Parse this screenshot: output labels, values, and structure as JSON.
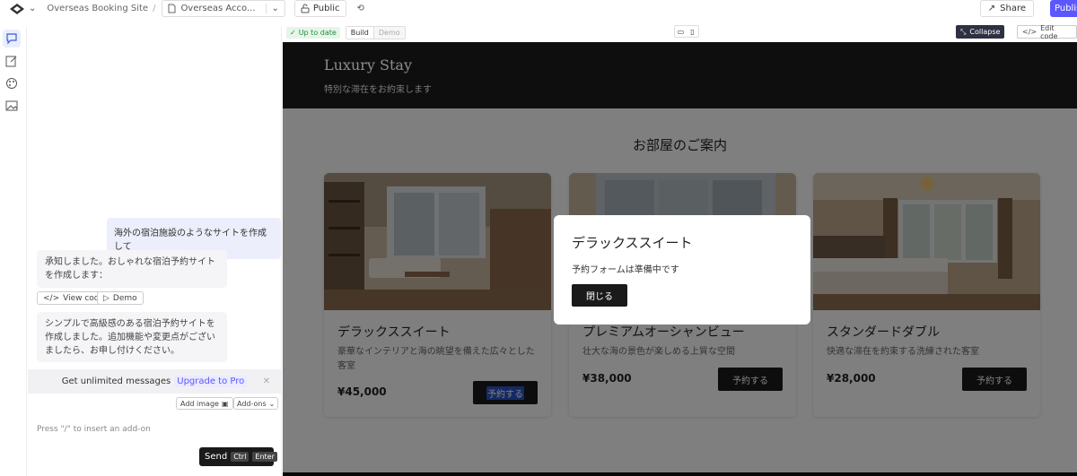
{
  "topbar": {
    "breadcrumb": "Overseas Booking Site",
    "page_name": "Overseas Acco...",
    "visibility": "Public",
    "share": "Share",
    "publish": "Publish"
  },
  "chat": {
    "user_message": "海外の宿泊施設のようなサイトを作成して",
    "bot_message_1": "承知しました。おしゃれな宿泊予約サイトを作成します：",
    "view_code": "View code",
    "demo": "Demo",
    "bot_message_2": "シンプルで高級感のある宿泊予約サイトを作成しました。追加機能や変更点がございましたら、お申し付けください。",
    "upgrade_text": "Get unlimited messages",
    "upgrade_link": "Upgrade to Pro",
    "add_image": "Add image",
    "addons": "Add-ons",
    "input_placeholder": "Press \"/\" to insert an add-on",
    "send": "Send",
    "kbd_ctrl": "Ctrl",
    "kbd_enter": "Enter"
  },
  "preview_toolbar": {
    "status": "Up to date",
    "build": "Build",
    "demo": "Demo",
    "collapse": "Collapse",
    "edit_code": "Edit code"
  },
  "site": {
    "title": "Luxury Stay",
    "subtitle": "特別な滞在をお約束します",
    "section_title": "お部屋のご案内",
    "rooms": [
      {
        "name": "デラックススイート",
        "desc": "豪華なインテリアと海の眺望を備えた広々とした客室",
        "price": "¥45,000",
        "button": "予約する"
      },
      {
        "name": "プレミアムオーシャンビュー",
        "desc": "壮大な海の景色が楽しめる上質な空間",
        "price": "¥38,000",
        "button": "予約する"
      },
      {
        "name": "スタンダードダブル",
        "desc": "快適な滞在を約束する洗練された客室",
        "price": "¥28,000",
        "button": "予約する"
      }
    ],
    "modal": {
      "title": "デラックススイート",
      "text": "予約フォームは準備中です",
      "close": "閉じる"
    }
  },
  "colors": {
    "accent": "#5b57ff",
    "dark": "#1a1a1a",
    "status_green": "#2b8a3e"
  }
}
